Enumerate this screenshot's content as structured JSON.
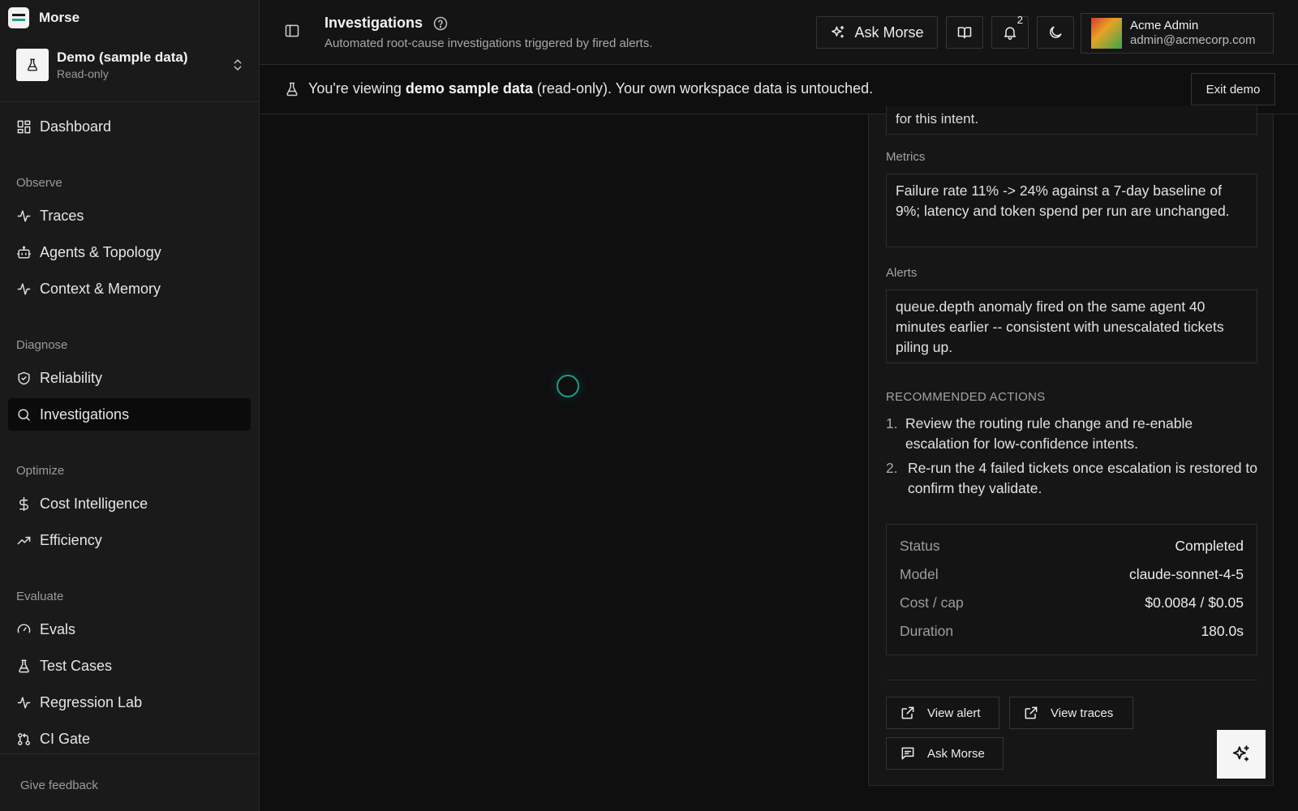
{
  "app": {
    "name": "Morse"
  },
  "workspace": {
    "name": "Demo (sample data)",
    "mode": "Read-only"
  },
  "sidebar": {
    "dashboard": "Dashboard",
    "sections": {
      "observe": "Observe",
      "diagnose": "Diagnose",
      "optimize": "Optimize",
      "evaluate": "Evaluate"
    },
    "items": {
      "traces": "Traces",
      "agents": "Agents & Topology",
      "context": "Context & Memory",
      "reliability": "Reliability",
      "investigations": "Investigations",
      "cost": "Cost Intelligence",
      "efficiency": "Efficiency",
      "evals": "Evals",
      "test_cases": "Test Cases",
      "regression": "Regression Lab",
      "ci_gate": "CI Gate"
    },
    "feedback": "Give feedback"
  },
  "header": {
    "title": "Investigations",
    "subtitle": "Automated root-cause investigations triggered by fired alerts.",
    "ask_label": "Ask Morse",
    "notification_count": "2",
    "user": {
      "name": "Acme Admin",
      "email": "admin@acmecorp.com"
    }
  },
  "banner": {
    "prefix": "You're viewing ",
    "bold": "demo sample data",
    "suffix": " (read-only). Your own workspace data is untouched.",
    "exit_label": "Exit demo"
  },
  "detail": {
    "partial_text": "for this intent.",
    "metrics_label": "Metrics",
    "metrics_text": "Failure rate 11% -> 24% against a 7-day baseline of 9%; latency and token spend per run are unchanged.",
    "alerts_label": "Alerts",
    "alerts_text": "queue.depth anomaly fired on the same agent 40 minutes earlier -- consistent with unescalated tickets piling up.",
    "actions_heading": "RECOMMENDED ACTIONS",
    "actions": [
      {
        "num": "1.",
        "text": "Review the routing rule change and re-enable escalation for low-confidence intents."
      },
      {
        "num": "2.",
        "text": "Re-run the 4 failed tickets once escalation is restored to confirm they validate."
      }
    ],
    "meta": {
      "status_label": "Status",
      "status_value": "Completed",
      "model_label": "Model",
      "model_value": "claude-sonnet-4-5",
      "cost_label": "Cost / cap",
      "cost_value": "$0.0084 / $0.05",
      "duration_label": "Duration",
      "duration_value": "180.0s"
    },
    "buttons": {
      "view_alert": "View alert",
      "view_traces": "View traces",
      "ask_morse": "Ask Morse"
    }
  },
  "colors": {
    "accent": "#1f9c88",
    "background": "#0f0f10",
    "panel": "#161617"
  }
}
